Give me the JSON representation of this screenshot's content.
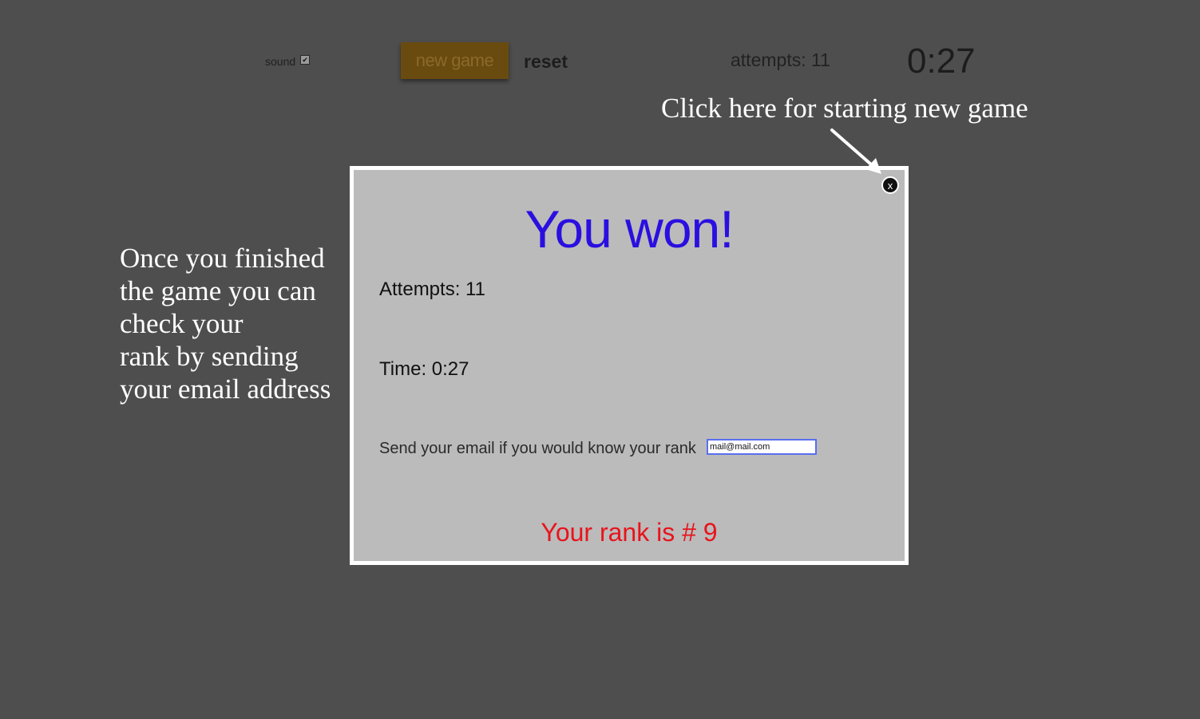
{
  "toolbar": {
    "sound_label": "sound",
    "sound_checked": true,
    "new_game_label": "new game",
    "reset_label": "reset",
    "attempts_text": "attempts: 11",
    "timer_text": "0:27"
  },
  "annotations": {
    "top_note": "Click here for starting new game",
    "left_note_lines": [
      "Once you finished",
      "the game you can",
      "check your",
      "rank by sending",
      "your email address"
    ]
  },
  "modal": {
    "close_label": "x",
    "title": "You won!",
    "attempts_text": "Attempts: 11",
    "time_text": "Time: 0:27",
    "email_prompt": "Send your email if you would know your rank",
    "email_value": "mail@mail.com",
    "rank_text": "Your rank is # 9"
  },
  "colors": {
    "background": "#4e4e4e",
    "new_game_button": "#6a4b0f",
    "modal_background": "#bbbbbb",
    "title": "#2a0fe0",
    "rank": "#e8141c"
  },
  "icons": {
    "arrow": "arrow-pointing-to-close-icon",
    "close": "close-icon"
  }
}
